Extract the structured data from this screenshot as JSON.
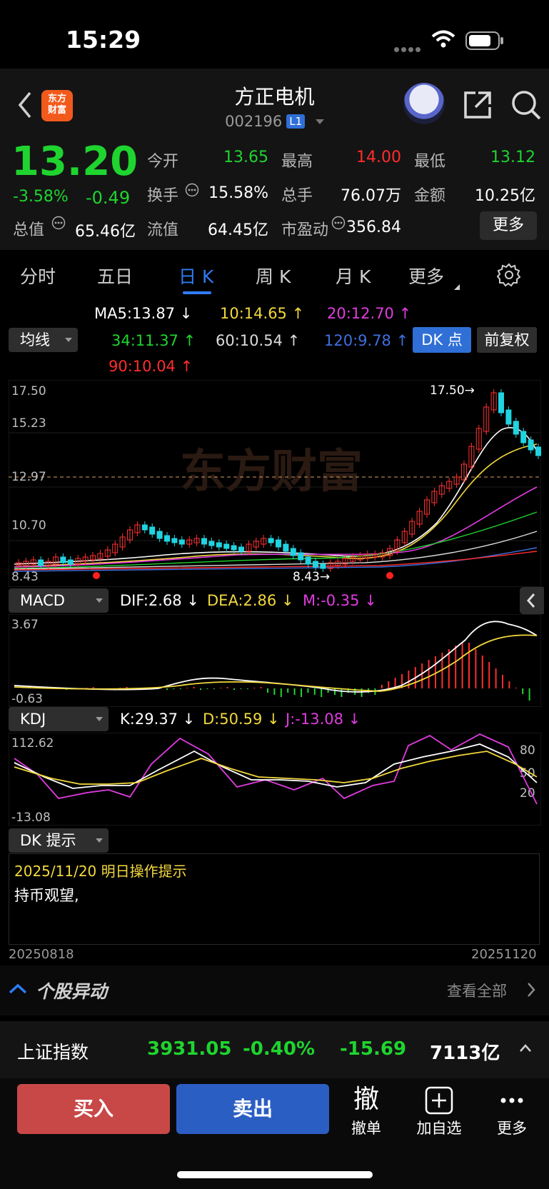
{
  "status_bar": {
    "time": "15:29"
  },
  "header": {
    "logo_text_line1": "东方",
    "logo_text_line2": "财富",
    "stock_name": "方正电机",
    "stock_code": "002196",
    "level_badge": "L1"
  },
  "quote": {
    "price": "13.20",
    "change_pct": "-3.58%",
    "change": "-0.49",
    "rows": [
      [
        {
          "label": "今开",
          "value": "13.65",
          "color": "#1fd42f"
        },
        {
          "label": "最高",
          "value": "14.00",
          "color": "#ff2d2d"
        },
        {
          "label": "最低",
          "value": "13.12",
          "color": "#1fd42f"
        }
      ],
      [
        {
          "label": "换手",
          "value": "15.58%",
          "color": "#ffffff"
        },
        {
          "label": "总手",
          "value": "76.07万",
          "color": "#ffffff"
        },
        {
          "label": "金额",
          "value": "10.25亿",
          "color": "#ffffff"
        }
      ],
      [
        {
          "label": "总值",
          "value": "65.46亿",
          "color": "#ffffff"
        },
        {
          "label": "流值",
          "value": "64.45亿",
          "color": "#ffffff"
        },
        {
          "label": "市盈动",
          "value": "356.84",
          "color": "#ffffff"
        }
      ]
    ],
    "more_label": "更多"
  },
  "tabs": {
    "items": [
      "分时",
      "五日",
      "日 K",
      "周 K",
      "月 K",
      "更多"
    ],
    "active": "日 K"
  },
  "ma_legend": {
    "selector_label": "均线",
    "items": [
      {
        "text": "MA5:13.87 ↓",
        "color": "#ffffff"
      },
      {
        "text": "10:14.65 ↑",
        "color": "#f2d83c"
      },
      {
        "text": "20:12.70 ↑",
        "color": "#e03cdf"
      },
      {
        "text": "34:11.37 ↑",
        "color": "#1fd42f"
      },
      {
        "text": "60:10.54 ↑",
        "color": "#dcdcdc"
      },
      {
        "text": "120:9.78 ↑",
        "color": "#3f6fe0"
      },
      {
        "text": "90:10.04 ↑",
        "color": "#ff2d2d"
      }
    ],
    "dk_button": "DK 点",
    "adjust_button": "前复权"
  },
  "main_panel": {
    "y_labels": [
      "17.50",
      "15.23",
      "12.97",
      "10.70",
      "8.43"
    ],
    "high_annotation": "17.50→",
    "low_annotation": "8.43→",
    "watermark": "东方财富",
    "current_price_line": "12.97"
  },
  "macd_panel": {
    "selector_label": "MACD",
    "dif": "DIF:2.68 ↓",
    "dea": "DEA:2.86 ↓",
    "m": "M:-0.35 ↓",
    "y_top": "3.67",
    "y_bottom": "-0.63"
  },
  "kdj_panel": {
    "selector_label": "KDJ",
    "k": "K:29.37 ↓",
    "d": "D:50.59 ↓",
    "j": "J:-13.08 ↓",
    "y_top": "112.62",
    "y_bottom": "-13.08",
    "levels": [
      "80",
      "50",
      "20"
    ]
  },
  "dk_panel": {
    "selector_label": "DK 提示",
    "date_line": "2025/11/20 明日操作提示",
    "text": "持币观望,"
  },
  "date_axis": {
    "start": "20250818",
    "end": "20251120"
  },
  "anomaly": {
    "title": "个股异动",
    "view_all": "查看全部"
  },
  "index_bar": {
    "name": "上证指数",
    "value": "3931.05",
    "pct": "-0.40%",
    "change": "-15.69",
    "amount": "7113亿"
  },
  "actions": {
    "buy": "买入",
    "sell": "卖出",
    "cancel_icon": "撤",
    "cancel_label": "撤单",
    "add_label": "加自选",
    "more_label": "更多"
  },
  "colors": {
    "up": "#ff2d2d",
    "down": "#1fd42f",
    "accent": "#2f7cf6"
  }
}
